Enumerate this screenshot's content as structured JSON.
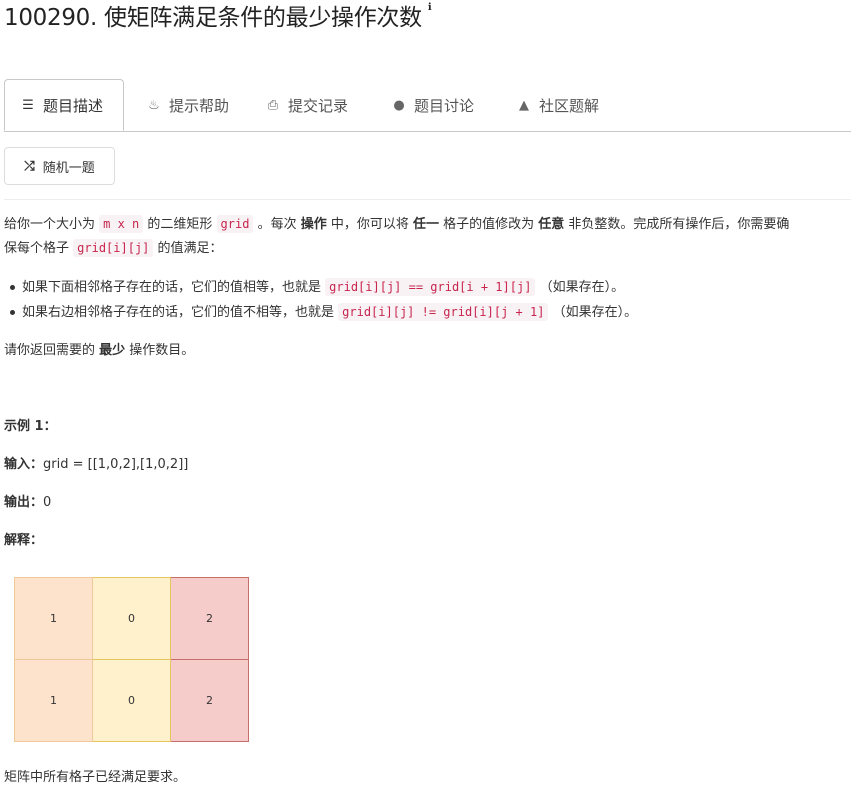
{
  "title": "100290. 使矩阵满足条件的最少操作次数",
  "tabs": [
    {
      "label": "题目描述",
      "icon": "list-icon"
    },
    {
      "label": "提示帮助",
      "icon": "bulb-icon"
    },
    {
      "label": "提交记录",
      "icon": "file-code-icon"
    },
    {
      "label": "题目讨论",
      "icon": "comments-icon"
    },
    {
      "label": "社区题解",
      "icon": "flask-icon"
    }
  ],
  "random_button": {
    "label": "随机一题",
    "icon": "shuffle-icon"
  },
  "desc": {
    "t1": "给你一个大小为 ",
    "code1": "m x n",
    "t2": " 的二维矩形 ",
    "code2": "grid",
    "t3": " 。每次 ",
    "b1": "操作",
    "t4": " 中，你可以将 ",
    "b2": "任一",
    "t5": " 格子的值修改为 ",
    "b3": "任意",
    "t6": " 非负整数。完成所有操作后，你需要确",
    "t7": "保每个格子 ",
    "code3": "grid[i][j]",
    "t8": " 的值满足："
  },
  "bullets": [
    {
      "pre": "如果下面相邻格子存在的话，它们的值相等，也就是 ",
      "code": "grid[i][j] == grid[i + 1][j]",
      "post": " （如果存在）。"
    },
    {
      "pre": "如果右边相邻格子存在的话，它们的值不相等，也就是 ",
      "code": "grid[i][j] != grid[i][j + 1]",
      "post": " （如果存在）。"
    }
  ],
  "ask": {
    "pre": "请你返回需要的 ",
    "bold": "最少",
    "post": " 操作数目。"
  },
  "example": {
    "heading": "示例 1：",
    "input_label": "输入：",
    "input_value": "grid = [[1,0,2],[1,0,2]]",
    "output_label": "输出：",
    "output_value": "0",
    "explain_label": "解释："
  },
  "matrix": [
    [
      "1",
      "0",
      "2"
    ],
    [
      "1",
      "0",
      "2"
    ]
  ],
  "matrix_colors": {
    "col0": "#fde3cc",
    "col1": "#fff1cc",
    "col2": "#f6cccb"
  },
  "note": "矩阵中所有格子已经满足要求。"
}
